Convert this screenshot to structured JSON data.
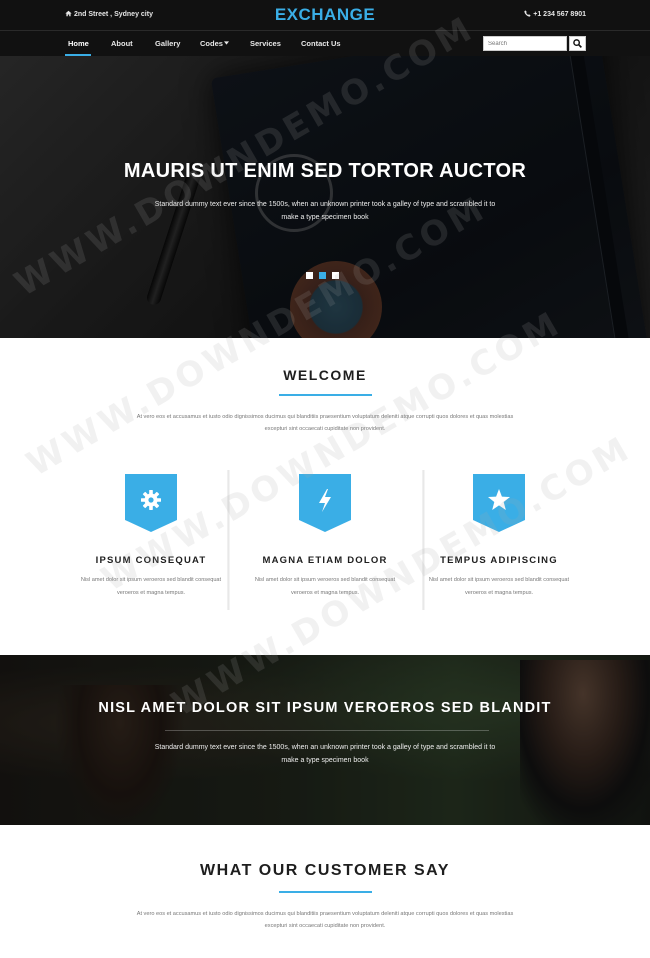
{
  "colors": {
    "accent": "#3aaee6",
    "dark": "#111111",
    "text": "#1e1e1e",
    "muted": "#777777"
  },
  "topbar": {
    "address": "2nd Street , Sydney city",
    "address_icon": "home-icon",
    "brand": "EXCHANGE",
    "phone": "+1 234 567 8901",
    "phone_icon": "phone-icon"
  },
  "nav": {
    "items": [
      "Home",
      "About",
      "Gallery",
      "Codes",
      "Services",
      "Contact Us"
    ],
    "active": "Home",
    "dropdown_item": "Codes",
    "search_placeholder": "Search",
    "search_icon": "search-icon"
  },
  "hero": {
    "title": "MAURIS UT ENIM SED TORTOR AUCTOR",
    "text": "Standard dummy text ever since the 1500s, when an unknown printer took a galley of type and scrambled it to make a type specimen book",
    "slides": 3,
    "active_slide": 2
  },
  "welcome": {
    "title": "WELCOME",
    "text": "At vero eos et accusamus et iusto odio dignissimos ducimus qui blanditiis praesentium voluptatum deleniti atque corrupti quos dolores et quas molestias excepturi sint occaecati cupiditate non provident."
  },
  "features": [
    {
      "icon": "gear-icon",
      "title": "IPSUM CONSEQUAT",
      "text": "Nisl amet dolor sit ipsum veroeros sed blandit consequat veroeros et magna tempus."
    },
    {
      "icon": "lightning-icon",
      "title": "MAGNA ETIAM DOLOR",
      "text": "Nisl amet dolor sit ipsum veroeros sed blandit consequat veroeros et magna tempus."
    },
    {
      "icon": "star-icon",
      "title": "TEMPUS ADIPISCING",
      "text": "Nisl amet dolor sit ipsum veroeros sed blandit consequat veroeros et magna tempus."
    }
  ],
  "band": {
    "title": "NISL AMET DOLOR SIT IPSUM VEROEROS SED BLANDIT",
    "text": "Standard dummy text ever since the 1500s, when an unknown printer took a galley of type and scrambled it to make a type specimen book"
  },
  "testimonials": {
    "title": "WHAT OUR CUSTOMER SAY",
    "text": "At vero eos et accusamus et iusto odio dignissimos ducimus qui blanditiis praesentium voluptatum deleniti atque corrupti quos dolores et quas molestias excepturi sint occaecati cupiditate non provident."
  },
  "watermark": "WWW.DOWNDEMO.COM"
}
